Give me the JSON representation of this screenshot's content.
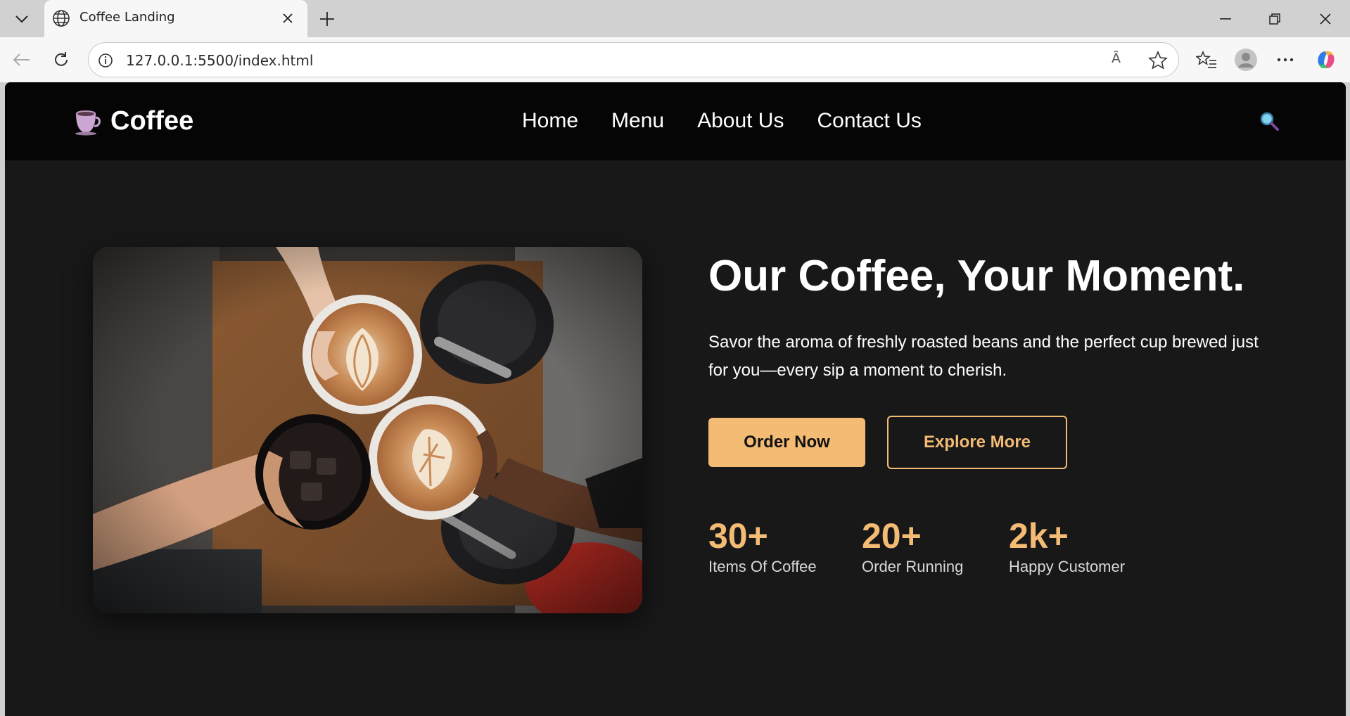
{
  "browser": {
    "tab_title": "Coffee Landing",
    "url": "127.0.0.1:5500/index.html",
    "read_aloud_glyph": "Ȃ"
  },
  "site": {
    "brand": "Coffee",
    "nav": [
      "Home",
      "Menu",
      "About Us",
      "Contact Us"
    ]
  },
  "hero": {
    "headline": "Our Coffee, Your Moment.",
    "subtext": "Savor the aroma of freshly roasted beans and the perfect cup brewed just for you—every sip a moment to cherish.",
    "primary_button": "Order Now",
    "secondary_button": "Explore More",
    "stats": [
      {
        "value": "30+",
        "label": "Items Of Coffee"
      },
      {
        "value": "20+",
        "label": "Order Running"
      },
      {
        "value": "2k+",
        "label": "Happy Customer"
      }
    ]
  },
  "colors": {
    "accent": "#f4bb74",
    "page_bg": "#181818",
    "header_bg": "#050505"
  }
}
